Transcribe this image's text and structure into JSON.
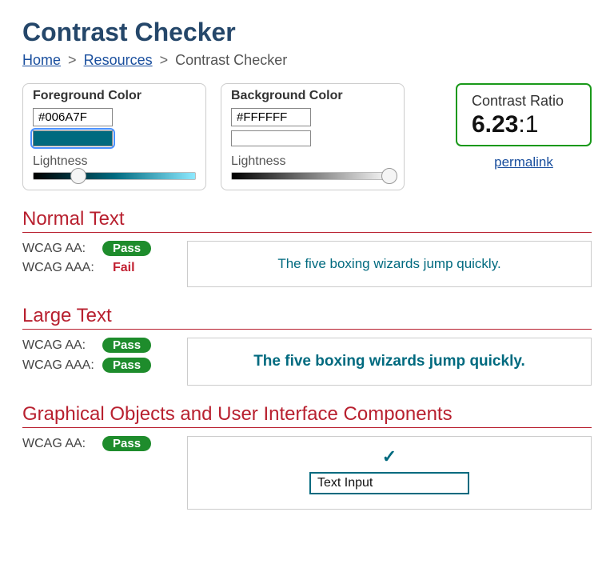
{
  "page_title": "Contrast Checker",
  "breadcrumb": {
    "home": "Home",
    "resources": "Resources",
    "current": "Contrast Checker",
    "sep": ">"
  },
  "foreground": {
    "label": "Foreground Color",
    "hex": "#006A7F",
    "swatch_color": "#006a7f",
    "lightness_label": "Lightness",
    "slider_pos_pct": 28,
    "gradient": "linear-gradient(to right, #000000, #006a7f 50%, #8de9ff 100%)"
  },
  "background": {
    "label": "Background Color",
    "hex": "#FFFFFF",
    "swatch_color": "#ffffff",
    "lightness_label": "Lightness",
    "slider_pos_pct": 97,
    "gradient": "linear-gradient(to right, #000000, #808080 50%, #ffffff 100%)"
  },
  "ratio": {
    "label": "Contrast Ratio",
    "value": "6.23",
    "suffix": ":1",
    "permalink": "permalink"
  },
  "sections": {
    "normal": {
      "heading": "Normal Text",
      "aa_label": "WCAG AA:",
      "aa_result": "Pass",
      "aaa_label": "WCAG AAA:",
      "aaa_result": "Fail",
      "sample": "The five boxing wizards jump quickly."
    },
    "large": {
      "heading": "Large Text",
      "aa_label": "WCAG AA:",
      "aa_result": "Pass",
      "aaa_label": "WCAG AAA:",
      "aaa_result": "Pass",
      "sample": "The five boxing wizards jump quickly."
    },
    "ui": {
      "heading": "Graphical Objects and User Interface Components",
      "aa_label": "WCAG AA:",
      "aa_result": "Pass",
      "input_value": "Text Input"
    }
  }
}
